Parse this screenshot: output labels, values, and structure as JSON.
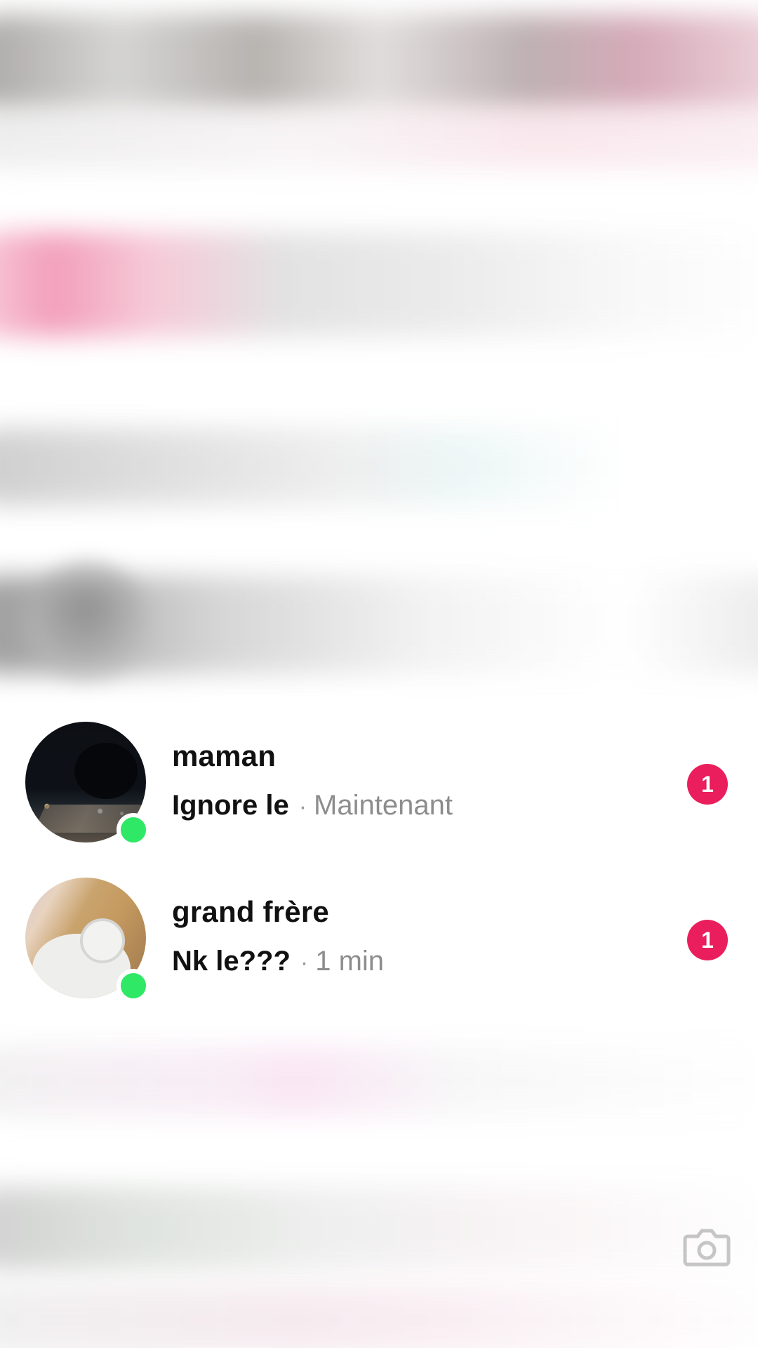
{
  "conversations": [
    {
      "name": "maman",
      "message": "Ignore le",
      "separator": "·",
      "time": "Maintenant",
      "unread_count": "1",
      "online": true,
      "avatar_icon": "night-park-avatar"
    },
    {
      "name": "grand frère",
      "message": "Nk le???",
      "separator": "·",
      "time": "1 min",
      "unread_count": "1",
      "online": true,
      "avatar_icon": "hoodie-selfie-avatar"
    }
  ],
  "colors": {
    "badge": "#ea1e5c",
    "online": "#2ee866",
    "name_text": "#111111",
    "time_text": "#8d8d8d"
  },
  "icons": {
    "camera": "camera-icon"
  }
}
